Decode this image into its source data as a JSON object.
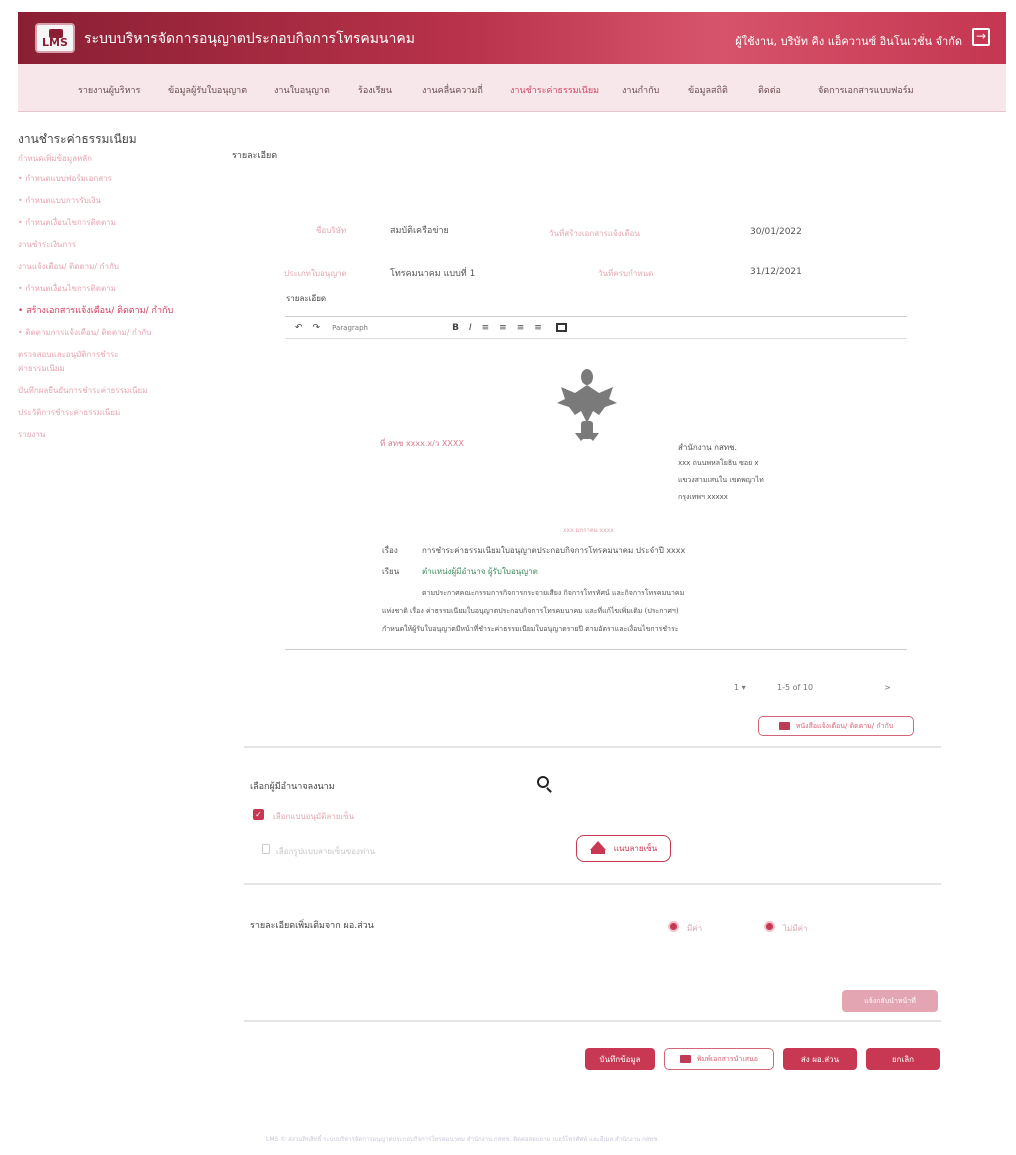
{
  "header": {
    "logo_text": "LMS",
    "app_title": "ระบบบริหารจัดการอนุญาตประกอบกิจการโทรคมนาคม",
    "user": "ผู้ใช้งาน, บริษัท คิง แอ็ควานซ์ อินโนเวชั่น จำกัด",
    "logout_icon": "logout-icon"
  },
  "nav": {
    "items": [
      "รายงานผู้บริหาร",
      "ข้อมูลผู้รับใบอนุญาต",
      "งานใบอนุญาต",
      "ร้องเรียน",
      "งานคลื่นความถี่",
      "งานชำระค่าธรรมเนียม",
      "งานกำกับ",
      "ข้อมูลสถิติ",
      "ติดต่อ",
      "จัดการเอกสารแบบฟอร์ม"
    ],
    "active_index": 5
  },
  "sidebar": {
    "title": "งานชำระค่าธรรมเนียม",
    "items": [
      "กำหนดเพิ่มข้อมูลหลัก",
      "• กำหนดแบบฟอร์มเอกสาร",
      "• กำหนดแบบการรับเงิน",
      "• กำหนดเงื่อนไขการติดตาม",
      "งานชำระเงินการ",
      "งานแจ้งเตือน/ ติดตาม/ กำกับ",
      "• กำหนดเงื่อนไขการติดตาม",
      "• สร้างเอกสารแจ้งเตือน/ ติดตาม/ กำกับ",
      "• ติดตามการแจ้งเตือน/ ติดตาม/ กำกับ",
      "ตรวจสอบและอนุมัติการชำระ",
      "ค่าธรรมเนียม",
      "บันทึกผลยืนยันการชำระค่าธรรมเนียม",
      "ประวัติการชำระค่าธรรมเนียม",
      "รายงาน"
    ],
    "active_index": 7
  },
  "detail": {
    "section_title": "รายละเอียด",
    "fields": [
      {
        "label": "ชื่อบริษัท",
        "value": "สมบัติเครือข่าย"
      },
      {
        "label": "วันที่สร้างเอกสารแจ้งเตือน",
        "value": "30/01/2022"
      },
      {
        "label": "ประเภทใบอนุญาต",
        "value": "โทรคมนาคม แบบที่ 1"
      },
      {
        "label": "วันที่ครบกำหนด",
        "value": "31/12/2021"
      }
    ],
    "editor_label": "รายละเอียด",
    "toolbar": {
      "undo": "↶",
      "redo": "↷",
      "font_select": "Paragraph",
      "bold": "B",
      "italic": "I",
      "align_left": "≡",
      "align_center": "≡",
      "align_right": "≡",
      "align_justify": "≡",
      "image_icon": "image-icon"
    },
    "document": {
      "ref_no": "ที่ สทช xxxx.x/ว XXXX",
      "office_lines": [
        "สำนักงาน กสทช.",
        "xxx ถนนพหลโยธิน ซอย x",
        "แขวงสามเสนใน เขตพญาไท",
        "กรุงเทพฯ xxxxx"
      ],
      "date_line": "xxx มกราคม xxxx",
      "subject_label": "เรื่อง",
      "subject": "การชำระค่าธรรมเนียมใบอนุญาตประกอบกิจการโทรคมนาคม ประจำปี xxxx",
      "to_label": "เรียน",
      "to": "ตำแหน่งผู้มีอำนาจ ผู้รับใบอนุญาต",
      "body": [
        "ตามประกาศคณะกรรมการกิจการกระจายเสียง กิจการโทรทัศน์ และกิจการโทรคมนาคม",
        "แห่งชาติ เรื่อง ค่าธรรมเนียมใบอนุญาตประกอบกิจการโทรคมนาคม และที่แก้ไขเพิ่มเติม (ประกาศฯ)",
        "กำหนดให้ผู้รับใบอนุญาตมีหน้าที่ชำระค่าธรรมเนียมใบอนุญาตรายปี ตามอัตราและเงื่อนไขการชำระ"
      ]
    },
    "pager": {
      "rows_select": "1 ▾",
      "range": "1-5 of 10",
      "next": ">"
    },
    "print_button": "หนังสือแจ้งเตือน/ ติดตาม/ กำกับ"
  },
  "signer": {
    "label": "เลือกผู้มีอำนาจลงนาม",
    "checkbox_label": "เลือกแบบอนุมัติลายเซ็น",
    "file_label": "เลือกรูปแบบลายเซ็นของท่าน",
    "upload_label": "แนบลายเซ็น"
  },
  "extra": {
    "label": "รายละเอียดเพิ่มเติมจาก ผอ.ส่วน",
    "radio_yes": "มีค่า",
    "radio_no": "ไม่มีค่า",
    "disabled_button": "แจ้งกลับนำหน้าที่"
  },
  "actions": {
    "save": "บันทึกข้อมูล",
    "print": "พิมพ์เอกสารนำเสนอ",
    "send": "ส่ง ผอ.ส่วน",
    "cancel": "ยกเลิก"
  },
  "footer": "LMS © สงวนลิขสิทธิ์ ระบบบริหารจัดการอนุญาตประกอบกิจการโทรคมนาคม สำนักงาน กสทช. ติดต่อสอบถาม เบอร์โทรศัพท์ และอีเมล สำนักงาน กสทช."
}
